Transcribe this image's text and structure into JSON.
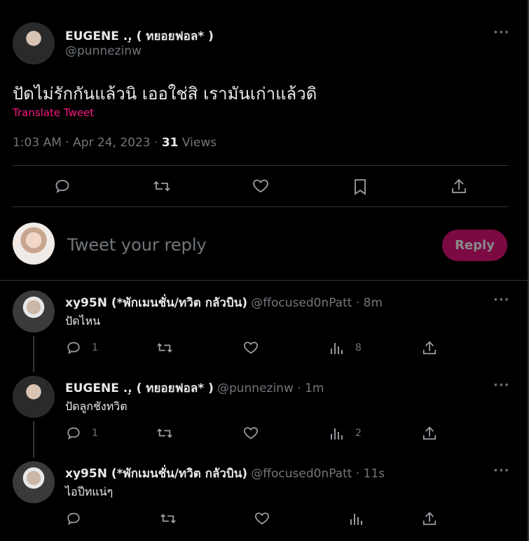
{
  "main_tweet": {
    "display_name": "EUGENE ..̧ ( ทยอยฟอล* )",
    "handle": "@punnezinw",
    "text": "ปัดไม่รักกันแล้วนิ เออใช่สิ เรามันเก่าแล้วดิ",
    "translate_label": "Translate Tweet",
    "timestamp": "1:03 AM · Apr 24, 2023 · ",
    "views_count": "31",
    "views_label": " Views",
    "more_icon": "more-icon"
  },
  "composer": {
    "placeholder": "Tweet your reply",
    "reply_button": "Reply"
  },
  "replies": [
    {
      "display_name": "xy95N (*พักเมนชั่น/ทวิต กลัวบิน)",
      "meta": "@ffocused0nPatt · 8m",
      "text": "ปัดไหน",
      "reply_count": "1",
      "view_count": "8"
    },
    {
      "display_name": "EUGENE ..̧ ( ทยอยฟอล* )",
      "meta": "@punnezinw · 1m",
      "text": "ปัดลูกชังทวิต",
      "reply_count": "1",
      "view_count": "2"
    },
    {
      "display_name": "xy95N (*พักเมนชั่น/ทวิต กลัวบิน)",
      "meta": "@ffocused0nPatt · 11s",
      "text": "ไอปีทแน่ๆ",
      "reply_count": "",
      "view_count": ""
    }
  ],
  "colors": {
    "accent": "#f91880",
    "reply_button_bg": "#7b0a43",
    "divider": "#2f3336",
    "muted": "#71767b"
  }
}
